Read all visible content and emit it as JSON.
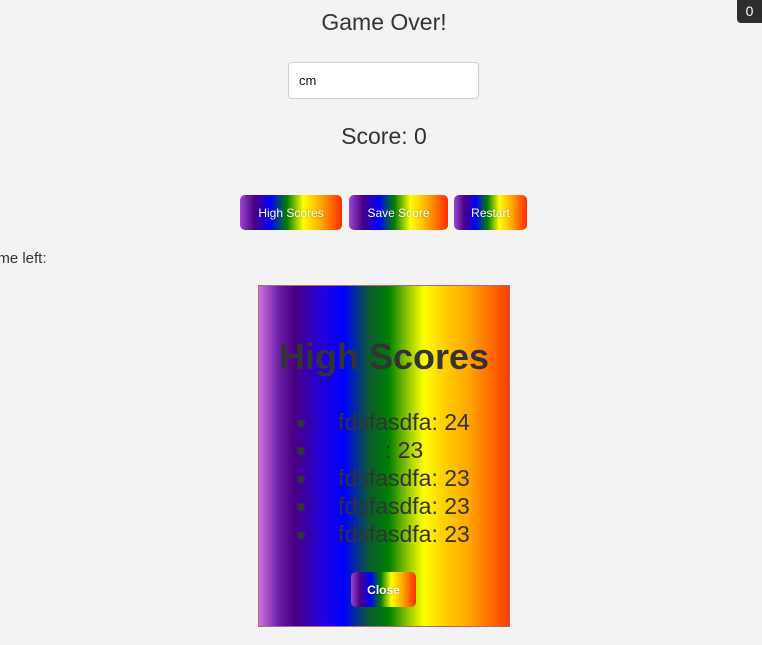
{
  "game": {
    "title": "Game Over!",
    "name_value": "cm",
    "score_label": "Score: 0",
    "time_left_label": "ime left:",
    "counter": "0"
  },
  "buttons": {
    "high_scores": "High Scores",
    "save_score": "Save Score",
    "restart": "Restart"
  },
  "modal": {
    "title": "High Scores",
    "close_label": "Close",
    "entries": [
      {
        "name": "fdsfasdfa",
        "score": "24",
        "text": "fdsfasdfa: 24"
      },
      {
        "name": "",
        "score": "23",
        "text": ": 23"
      },
      {
        "name": "fdsfasdfa",
        "score": "23",
        "text": "fdsfasdfa: 23"
      },
      {
        "name": "fdsfasdfa",
        "score": "23",
        "text": "fdsfasdfa: 23"
      },
      {
        "name": "fdsfasdfa",
        "score": "23",
        "text": "fdsfasdfa: 23"
      }
    ]
  },
  "colors": {
    "background": "#f3f3f3",
    "rainbow": [
      "#9a47d2",
      "#4b0082",
      "#0000ff",
      "#008000",
      "#ffff00",
      "#ffa500",
      "#ff2a00"
    ],
    "counter_badge": "#2d2d2d"
  }
}
